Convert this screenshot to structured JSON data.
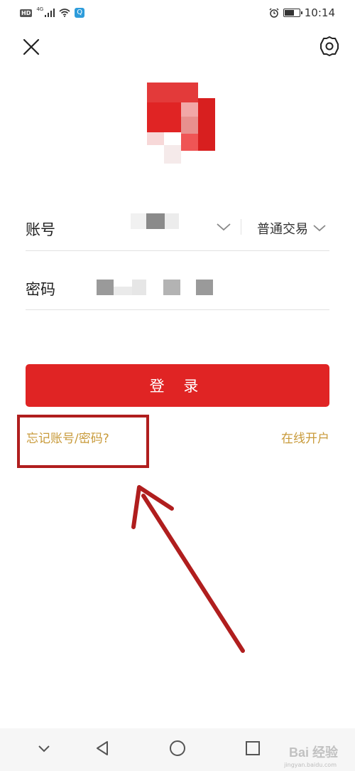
{
  "status_bar": {
    "network_label": "HD",
    "signal_label": "4G",
    "time": "10:14"
  },
  "icons": {
    "close": "close-icon",
    "settings": "gear-icon",
    "dropdown": "chevron-down-icon"
  },
  "form": {
    "account_label": "账号",
    "password_label": "密码",
    "trading_mode": "普通交易"
  },
  "login_button": "登 录",
  "links": {
    "forgot": "忘记账号/密码?",
    "open_account": "在线开户"
  },
  "nav_bar": {
    "buttons": [
      "chevron-down-icon",
      "back-triangle-icon",
      "home-circle-icon",
      "recents-square-icon"
    ]
  },
  "watermark": {
    "text": "Bai 经验",
    "sub": "jingyan.baidu.com"
  },
  "colors": {
    "accent": "#e02424",
    "link": "#c89a3a",
    "annotation": "#b01e1e"
  }
}
